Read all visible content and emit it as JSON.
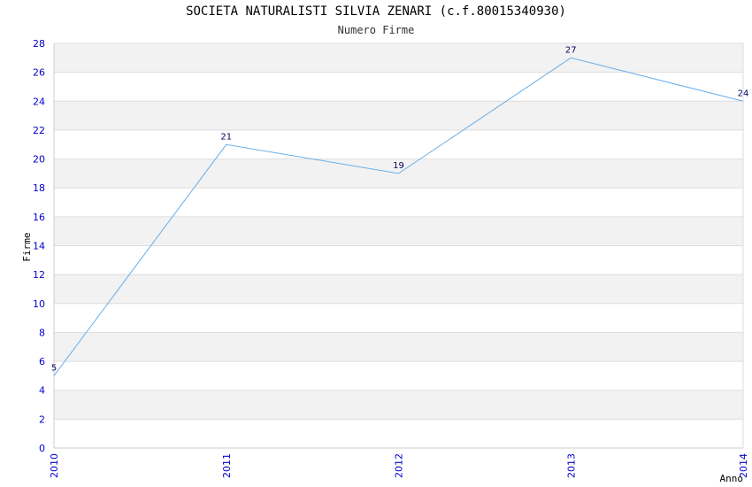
{
  "chart_data": {
    "type": "line",
    "title": "SOCIETA NATURALISTI SILVIA ZENARI (c.f.80015340930)",
    "subtitle": "Numero Firme",
    "xlabel": "Anno",
    "ylabel": "Firme",
    "x": [
      "2010",
      "2011",
      "2012",
      "2013",
      "2014"
    ],
    "series": [
      {
        "values": [
          5,
          21,
          19,
          27,
          24
        ]
      }
    ],
    "ylim": [
      0,
      28
    ],
    "ytick_step": 2,
    "grid": true,
    "line_color": "#6aaee8",
    "band_colors": [
      "#f2f2f2",
      "#ffffff"
    ],
    "tick_color": "#0000cc",
    "label_color": "#000066"
  }
}
